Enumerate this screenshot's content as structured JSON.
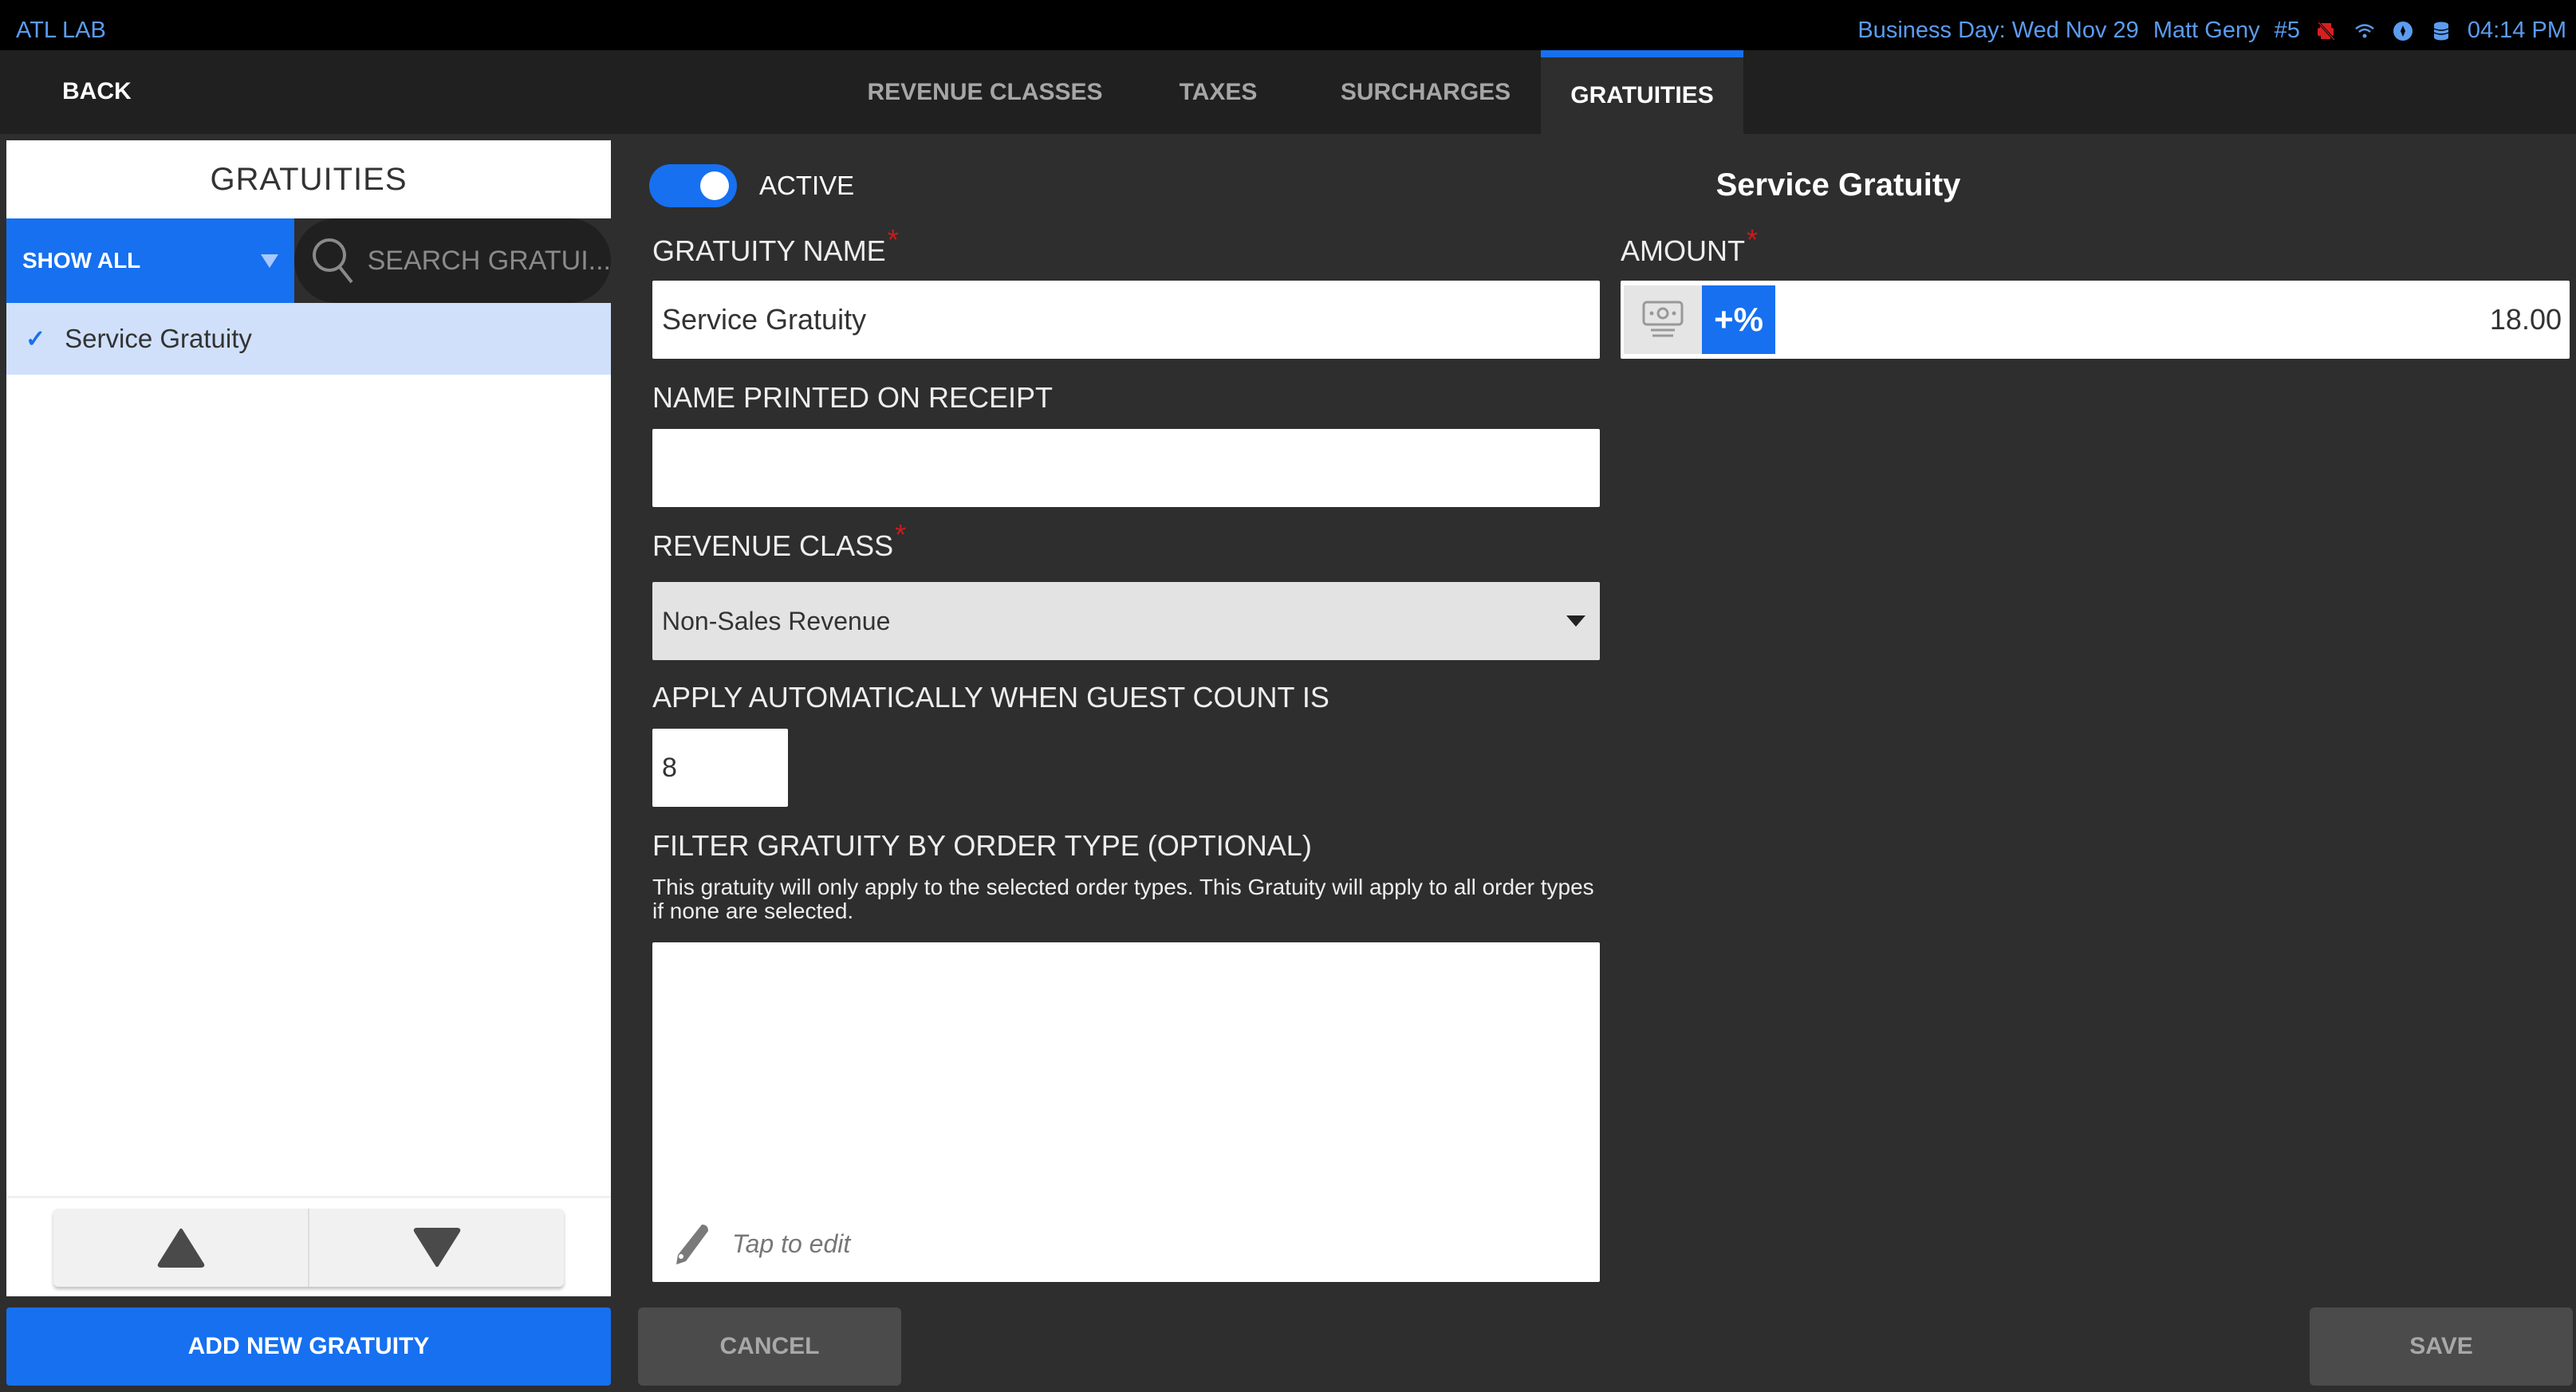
{
  "status_bar": {
    "app_name": "ATL LAB",
    "business_day": "Business Day: Wed Nov 29",
    "user": "Matt Geny",
    "terminal": "#5",
    "icons": [
      "printer-offline-icon",
      "wifi-icon",
      "sync-icon",
      "database-icon"
    ],
    "time": "04:14 PM",
    "colors": {
      "text": "#5b9cf0",
      "printer_offline": "#d42020"
    }
  },
  "nav": {
    "back_label": "BACK",
    "tabs": [
      {
        "label": "REVENUE CLASSES",
        "active": false
      },
      {
        "label": "TAXES",
        "active": false
      },
      {
        "label": "SURCHARGES",
        "active": false
      },
      {
        "label": "GRATUITIES",
        "active": true
      }
    ]
  },
  "left_panel": {
    "title": "GRATUITIES",
    "filter_label": "SHOW ALL",
    "search_placeholder": "SEARCH GRATUI...",
    "items": [
      {
        "label": "Service Gratuity",
        "selected": true
      }
    ],
    "move_up_icon": "triangle-up-icon",
    "move_down_icon": "triangle-down-icon",
    "add_button": "ADD NEW GRATUITY"
  },
  "form": {
    "active_label": "ACTIVE",
    "active": true,
    "title": "Service Gratuity",
    "gratuity_name_label": "GRATUITY NAME",
    "gratuity_name_value": "Service Gratuity",
    "required_mark": "*",
    "amount_label": "AMOUNT",
    "amount_mode": "+%",
    "amount_value": "18.00",
    "receipt_name_label": "NAME PRINTED ON RECEIPT",
    "receipt_name_value": "",
    "revenue_class_label": "REVENUE CLASS",
    "revenue_class_value": "Non-Sales Revenue",
    "guest_count_label": "APPLY AUTOMATICALLY WHEN GUEST COUNT IS",
    "guest_count_value": "8",
    "order_type_label": "FILTER GRATUITY BY ORDER TYPE (OPTIONAL)",
    "order_type_help": "This gratuity will only apply to the selected order types. This Gratuity will apply to all order types if none are selected.",
    "tap_to_edit": "Tap to edit",
    "cancel_label": "CANCEL",
    "save_label": "SAVE"
  },
  "colors": {
    "accent": "#1670f0",
    "background": "#2e2e2e",
    "nav_background": "#202020",
    "selected_item": "#d0e0fb",
    "required": "#c91c1c",
    "disabled_button": "#4b4b4b"
  }
}
